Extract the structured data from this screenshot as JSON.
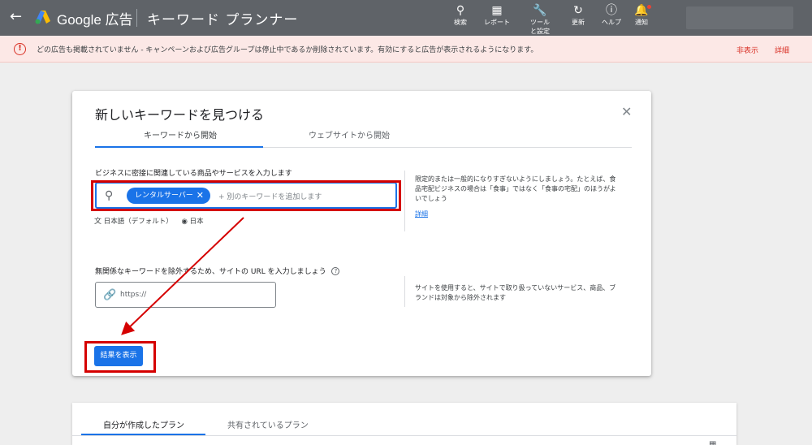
{
  "header": {
    "back_icon": "arrow-back-icon",
    "logo_icon": "google-ads-logo-icon",
    "brand": "Google 広告",
    "title": "キーワード プランナー",
    "tools": [
      {
        "icon": "search-icon",
        "label": "検索"
      },
      {
        "icon": "report-icon",
        "label": "レポート"
      },
      {
        "icon": "wrench-icon",
        "label": "ツールと設定"
      },
      {
        "icon": "refresh-icon",
        "label": "更新"
      },
      {
        "icon": "help-icon",
        "label": "ヘルプ"
      },
      {
        "icon": "bell-icon",
        "label": "通知"
      }
    ]
  },
  "alert": {
    "icon": "error-icon",
    "text": "どの広告も掲載されていません - キャンペーンおよび広告グループは停止中であるか削除されています。有効にすると広告が表示されるようになります。",
    "hide": "非表示",
    "details": "詳細"
  },
  "modal": {
    "title": "新しいキーワードを見つける",
    "close_icon": "close-icon",
    "tabs": [
      "キーワードから開始",
      "ウェブサイトから開始"
    ],
    "keywords": {
      "label": "ビジネスに密接に関連している商品やサービスを入力します",
      "chip": "レンタルサーバー",
      "placeholder": "+ 別のキーワードを追加します",
      "language": "日本語（デフォルト）",
      "location": "日本",
      "hint": "限定的または一般的になりすぎないようにしましょう。たとえば、食品宅配ビジネスの場合は「食事」ではなく「食事の宅配」のほうがよいでしょう",
      "hint_link": "詳細"
    },
    "url": {
      "label": "無関係なキーワードを除外するため、サイトの URL を入力しましょう",
      "placeholder": "https://",
      "hint": "サイトを使用すると、サイトで取り扱っていないサービス、商品、ブランドは対象から除外されます"
    },
    "submit": "結果を表示"
  },
  "plans": {
    "tabs": [
      "自分が作成したプラン",
      "共有されているプラン"
    ]
  },
  "colors": {
    "topbar": "#5f6368",
    "accent": "#1a73e8",
    "alert_bg": "#fce8e6",
    "alert_red": "#d93025",
    "annotation_red": "#d50000"
  }
}
